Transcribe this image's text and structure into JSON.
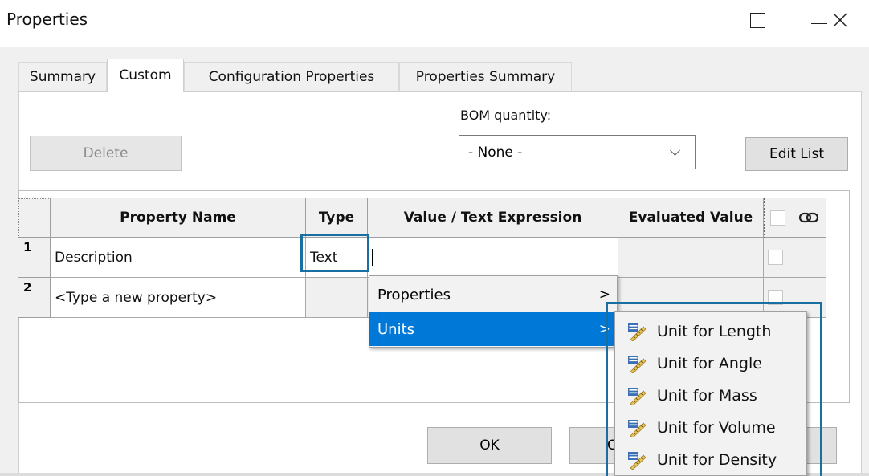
{
  "window": {
    "title": "Properties"
  },
  "tabs": [
    "Summary",
    "Custom",
    "Configuration Properties",
    "Properties Summary"
  ],
  "active_tab": "Custom",
  "toolbar": {
    "delete_label": "Delete",
    "bom_label": "BOM quantity:",
    "bom_value": "- None -",
    "edit_list_label": "Edit List"
  },
  "grid": {
    "headers": [
      "Property Name",
      "Type",
      "Value / Text Expression",
      "Evaluated Value"
    ],
    "rows": [
      {
        "num": "1",
        "name": "Description",
        "type": "Text",
        "value": "",
        "evaluated": ""
      },
      {
        "num": "2",
        "name": "<Type a new property>",
        "type": "",
        "value": "",
        "evaluated": ""
      }
    ]
  },
  "context_menu": {
    "items": [
      {
        "label": "Properties",
        "arrow": ">"
      },
      {
        "label": "Units",
        "arrow": ">"
      }
    ],
    "highlighted": "Units"
  },
  "units_submenu": {
    "items": [
      "Unit for Length",
      "Unit for Angle",
      "Unit for Mass",
      "Unit for Volume",
      "Unit for Density"
    ],
    "icon": "unit-ruler-icon"
  },
  "footer": {
    "ok_label": "OK",
    "cancel_partial": "C"
  },
  "colors": {
    "highlight": "#0078d7",
    "annotation_box": "#1a6ea0"
  }
}
